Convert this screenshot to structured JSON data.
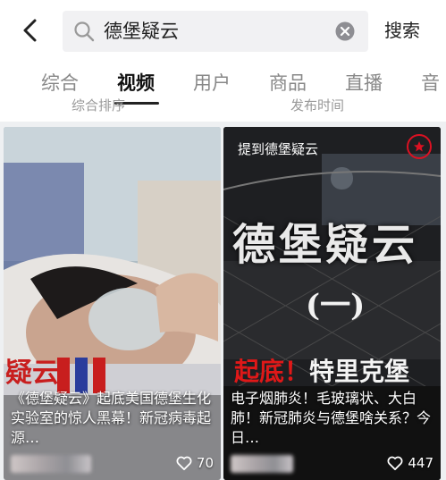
{
  "header": {
    "search_query": "德堡疑云",
    "search_button": "搜索"
  },
  "tabs": [
    {
      "label": "综合"
    },
    {
      "label": "视频"
    },
    {
      "label": "用户"
    },
    {
      "label": "商品"
    },
    {
      "label": "直播"
    },
    {
      "label": "音"
    }
  ],
  "filters": {
    "sort": "综合排序",
    "time": "发布时间"
  },
  "results": [
    {
      "caption": "《德堡疑云》起底美国德堡生化实验室的惊人黑幕！新冠病毒起源…",
      "likes": "70"
    },
    {
      "topic_tag": "提到德堡疑云",
      "cover_title": "德堡疑云",
      "cover_episode": "(一)",
      "cover_headline_red": "起底！",
      "cover_headline_white": "特里克堡",
      "caption": "电子烟肺炎！毛玻璃状、大白肺！新冠肺炎与德堡啥关系？今日…",
      "likes": "447"
    }
  ],
  "colors": {
    "search_bg": "#f1f1f3",
    "active_tab": "#111111",
    "inactive_tab": "#888888",
    "accent_red": "#e01818"
  }
}
